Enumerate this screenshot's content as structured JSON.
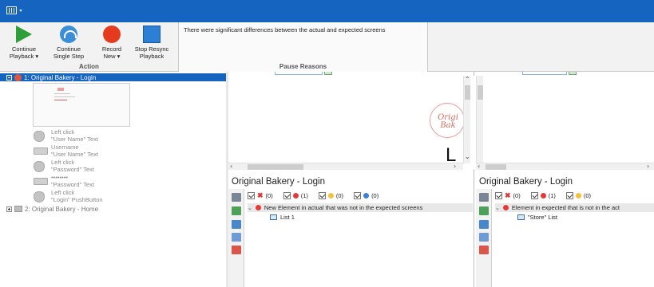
{
  "window": {
    "title": "",
    "accent": "#1565c0",
    "app_menu_icon": "app-menu-icon"
  },
  "ribbon": {
    "action_group": {
      "label": "Action",
      "buttons": [
        {
          "label": "Continue\nPlayback ▾",
          "icon": "play-icon"
        },
        {
          "label": "Continue\nSingle Step",
          "icon": "single-step-icon"
        },
        {
          "label": "Record\nNew ▾",
          "icon": "record-icon"
        },
        {
          "label": "Stop Resync\nPlayback",
          "icon": "stop-resync-icon"
        }
      ]
    },
    "pause_group": {
      "label": "Pause Reasons",
      "message": "There were significant differences between the actual and expected screens"
    }
  },
  "tree": {
    "root": {
      "label": "1: Original Bakery - Login",
      "expanded": true,
      "selected": true
    },
    "steps": [
      {
        "line1": "Left click",
        "line2": "\"User Name\" Text",
        "icon": "mouse-icon"
      },
      {
        "line1": "Username",
        "line2": "\"User Name\" Text",
        "icon": "keyboard-icon"
      },
      {
        "line1": "Left click",
        "line2": "\"Password\" Text",
        "icon": "mouse-icon"
      },
      {
        "line1": "••••••••",
        "line2": "\"Password\" Text",
        "icon": "keyboard-icon"
      },
      {
        "line1": "Left click",
        "line2": "\"Login\" PushButton",
        "icon": "mouse-icon"
      }
    ],
    "second": {
      "label": "2: Original Bakery - Home",
      "expanded": false
    }
  },
  "actual_pane": {
    "title": "Original Bakery - Login",
    "logo_text": "Origi\nBak",
    "big_letter": "L",
    "filters": [
      {
        "icon": "x-icon",
        "count": "(0)"
      },
      {
        "icon": "red-dot-icon",
        "count": "(1)"
      },
      {
        "icon": "yellow-dot-icon",
        "count": "(0)"
      },
      {
        "icon": "blue-dot-icon",
        "count": "(0)"
      }
    ],
    "diffs": [
      {
        "text": "New Element in actual that was not in the expected screens",
        "level": 0
      },
      {
        "text": "List 1",
        "level": 1
      }
    ]
  },
  "expected_pane": {
    "title": "Original Bakery - Login",
    "filters": [
      {
        "icon": "x-icon",
        "count": "(0)"
      },
      {
        "icon": "red-dot-icon",
        "count": "(1)"
      },
      {
        "icon": "yellow-dot-icon",
        "count": "(0)"
      }
    ],
    "diffs": [
      {
        "text": "Element in expected that is not in the act",
        "level": 0
      },
      {
        "text": "\"Store\" List",
        "level": 1
      }
    ]
  },
  "colors": {
    "red": "#e53a3a",
    "yellow": "#f3c23a",
    "blue": "#3b7fd6",
    "green": "#2e9e3a"
  }
}
